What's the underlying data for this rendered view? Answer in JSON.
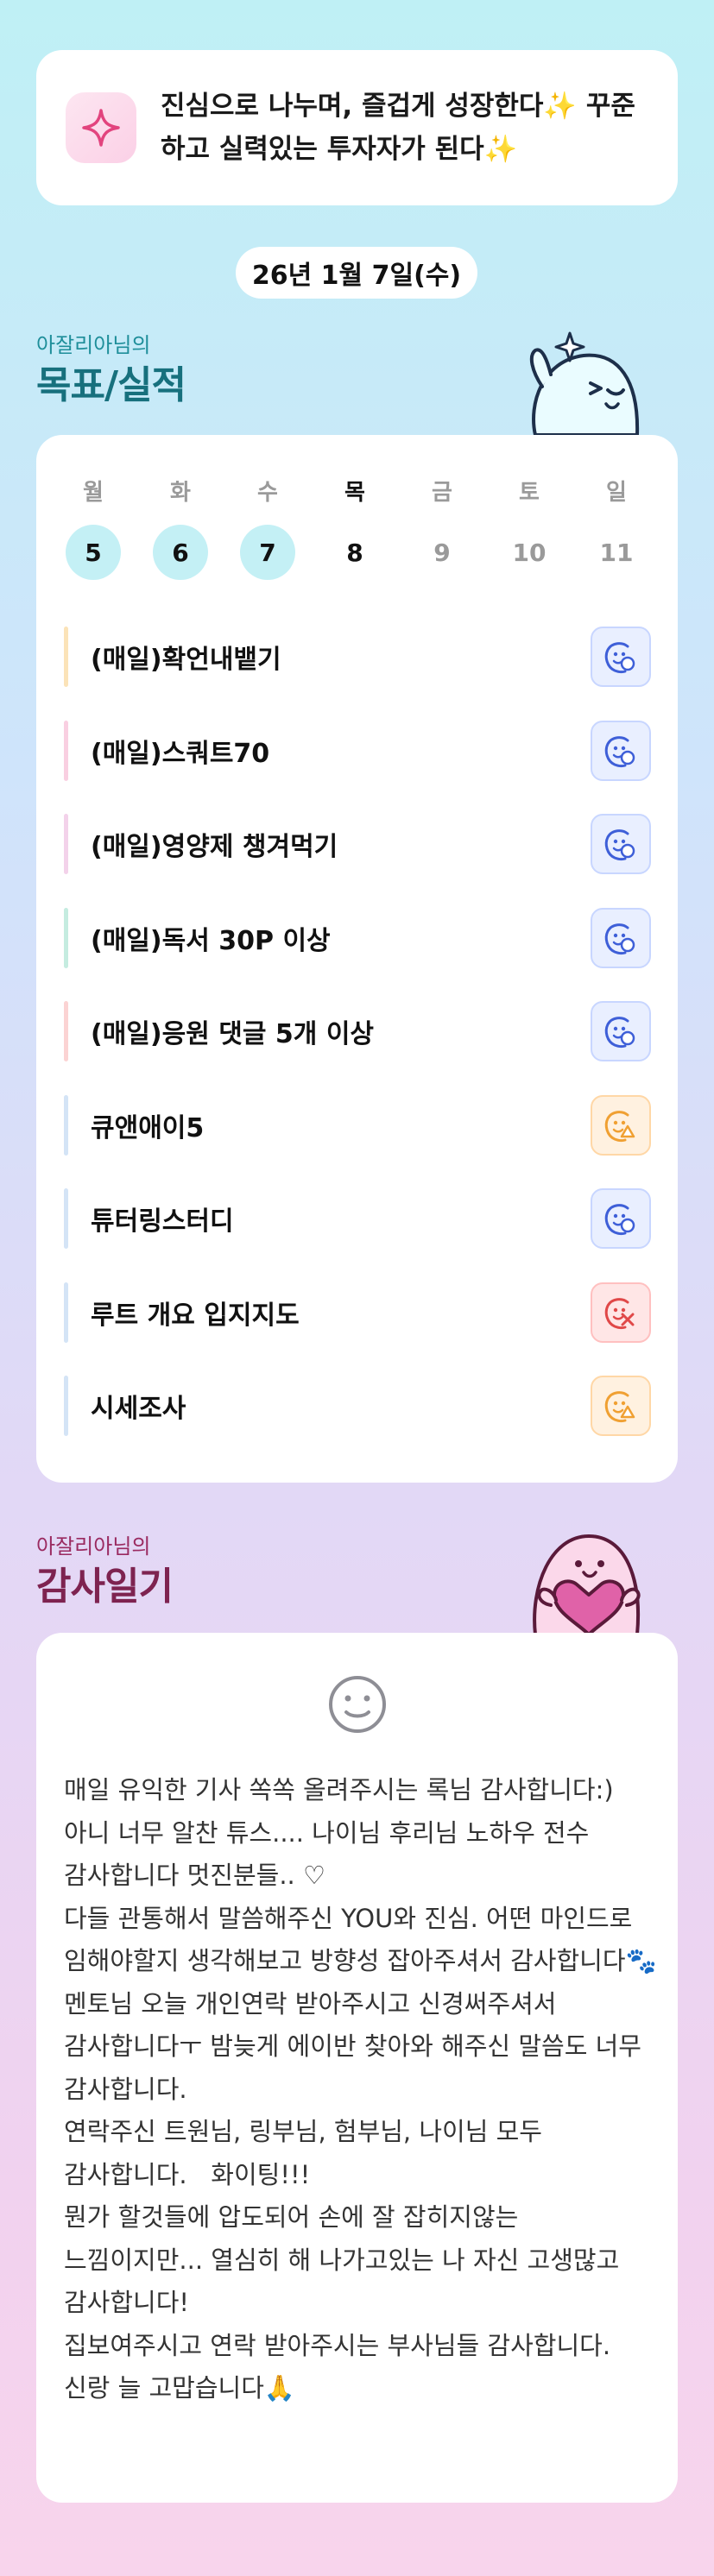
{
  "motto": {
    "text": "진심으로 나누며, 즐겁게 성장한다✨ 꾸준하고 실력있는 투자자가 된다✨"
  },
  "date": "26년 1월 7일(수)",
  "goals_section": {
    "subtitle": "아잘리아님의",
    "title": "목표/실적"
  },
  "week": [
    {
      "day": "월",
      "num": "5",
      "state": "done"
    },
    {
      "day": "화",
      "num": "6",
      "state": "done"
    },
    {
      "day": "수",
      "num": "7",
      "state": "done"
    },
    {
      "day": "목",
      "num": "8",
      "state": "today"
    },
    {
      "day": "금",
      "num": "9",
      "state": "future"
    },
    {
      "day": "토",
      "num": "10",
      "state": "future"
    },
    {
      "day": "일",
      "num": "11",
      "state": "future"
    }
  ],
  "goals": [
    {
      "label": "(매일)확언내뱉기",
      "status": "done",
      "bar": "#fbe3b8"
    },
    {
      "label": "(매일)스쿼트70",
      "status": "done",
      "bar": "#f9cfe1"
    },
    {
      "label": "(매일)영양제 챙겨먹기",
      "status": "done",
      "bar": "#f3d2ea"
    },
    {
      "label": "(매일)독서 30P 이상",
      "status": "done",
      "bar": "#c5ece0"
    },
    {
      "label": "(매일)응원 댓글 5개 이상",
      "status": "done",
      "bar": "#fbd3d3"
    },
    {
      "label": "큐앤애이5",
      "status": "partial",
      "bar": "#d4e4f6"
    },
    {
      "label": "튜터링스터디",
      "status": "done",
      "bar": "#d4e4f6"
    },
    {
      "label": "루트 개요 입지지도",
      "status": "failed",
      "bar": "#d4e4f6"
    },
    {
      "label": "시세조사",
      "status": "partial",
      "bar": "#d4e4f6"
    }
  ],
  "gratitude_section": {
    "subtitle": "아잘리아님의",
    "title": "감사일기"
  },
  "gratitude_text": "매일 유익한 기사 쏙쏙 올려주시는 록님 감사합니다:)\n아니 너무 알찬 튜스.... 나이님 후리님 노하우 전수 감사합니다 멋진분들.. ♡\n다들 관통해서 말씀해주신 YOU와 진심. 어떤 마인드로 임해야할지 생각해보고 방향성 잡아주셔서 감사합니다🐾\n멘토님 오늘 개인연락 받아주시고 신경써주셔서  감사합니다ㅜ 밤늦게 에이반 찾아와 해주신 말씀도 너무 감사합니다.\n연락주신 트원님, 링부님, 험부님, 나이님 모두 감사합니다.   화이팅!!!\n뭔가 할것들에 압도되어 손에 잘 잡히지않는 느낌이지만... 열심히 해 나가고있는 나 자신 고생많고 감사합니다!\n집보여주시고 연락 받아주시는 부사님들 감사합니다. 신랑 늘 고맙습니다🙏",
  "colors": {
    "teal": "#1e8e9a",
    "plum": "#8a2a55",
    "done": "#3e5fd8",
    "partial": "#f0a032",
    "failed": "#e04848"
  }
}
